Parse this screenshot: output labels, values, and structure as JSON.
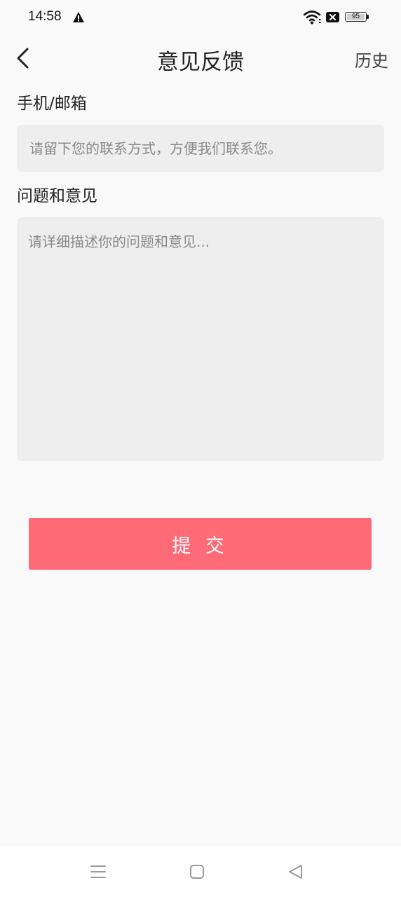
{
  "status_bar": {
    "time": "14:58",
    "battery": "95",
    "icons": [
      "warning-icon",
      "wifi-icon",
      "sim-disabled-icon",
      "battery-icon"
    ]
  },
  "header": {
    "title": "意见反馈",
    "history_label": "历史",
    "back_icon": "chevron-left-icon"
  },
  "form": {
    "contact_label": "手机/邮箱",
    "contact_value": "",
    "contact_placeholder": "请留下您的联系方式，方便我们联系您。",
    "feedback_label": "问题和意见",
    "feedback_value": "",
    "feedback_placeholder": "请详细描述你的问题和意见...",
    "submit_label": "提 交"
  },
  "nav_bar": {
    "icons": [
      "menu-icon",
      "home-icon",
      "back-triangle-icon"
    ]
  },
  "colors": {
    "background": "#f9f9f9",
    "input_background": "#eeeeee",
    "submit_button": "#fe6a75",
    "submit_text": "#ffffff"
  }
}
